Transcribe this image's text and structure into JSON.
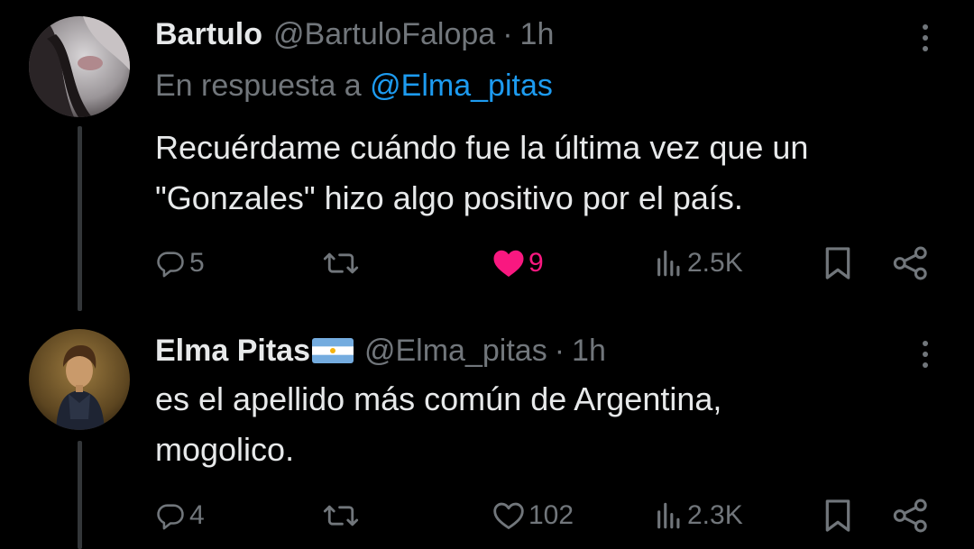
{
  "colors": {
    "background": "#000000",
    "text_primary": "#e7e9ea",
    "text_secondary": "#71767b",
    "link": "#1d9bf0",
    "like_active": "#f91880",
    "thread_line": "#333639"
  },
  "tweets": [
    {
      "display_name": "Bartulo",
      "handle": "@BartuloFalopa",
      "separator": "·",
      "time": "1h",
      "reply_prefix": "En respuesta a",
      "reply_to": "@Elma_pitas",
      "text_lines": [
        "Recuérdame cuándo fue la última vez que un",
        "\"Gonzales\" hizo algo positivo por el país."
      ],
      "actions": {
        "replies": "5",
        "retweets": "",
        "likes": "9",
        "liked": true,
        "views": "2.5K"
      },
      "icons": [
        "reply-icon",
        "retweet-icon",
        "heart-filled-icon",
        "views-icon",
        "bookmark-icon",
        "share-icon",
        "more-icon"
      ]
    },
    {
      "display_name": "Elma Pitas",
      "display_name_emoji": "argentina-flag",
      "handle": "@Elma_pitas",
      "separator": "·",
      "time": "1h",
      "text_lines": [
        "es el apellido más común de Argentina,",
        "mogolico."
      ],
      "actions": {
        "replies": "4",
        "retweets": "",
        "likes": "102",
        "liked": false,
        "views": "2.3K"
      },
      "icons": [
        "reply-icon",
        "retweet-icon",
        "heart-outline-icon",
        "views-icon",
        "bookmark-icon",
        "share-icon",
        "more-icon"
      ]
    }
  ]
}
